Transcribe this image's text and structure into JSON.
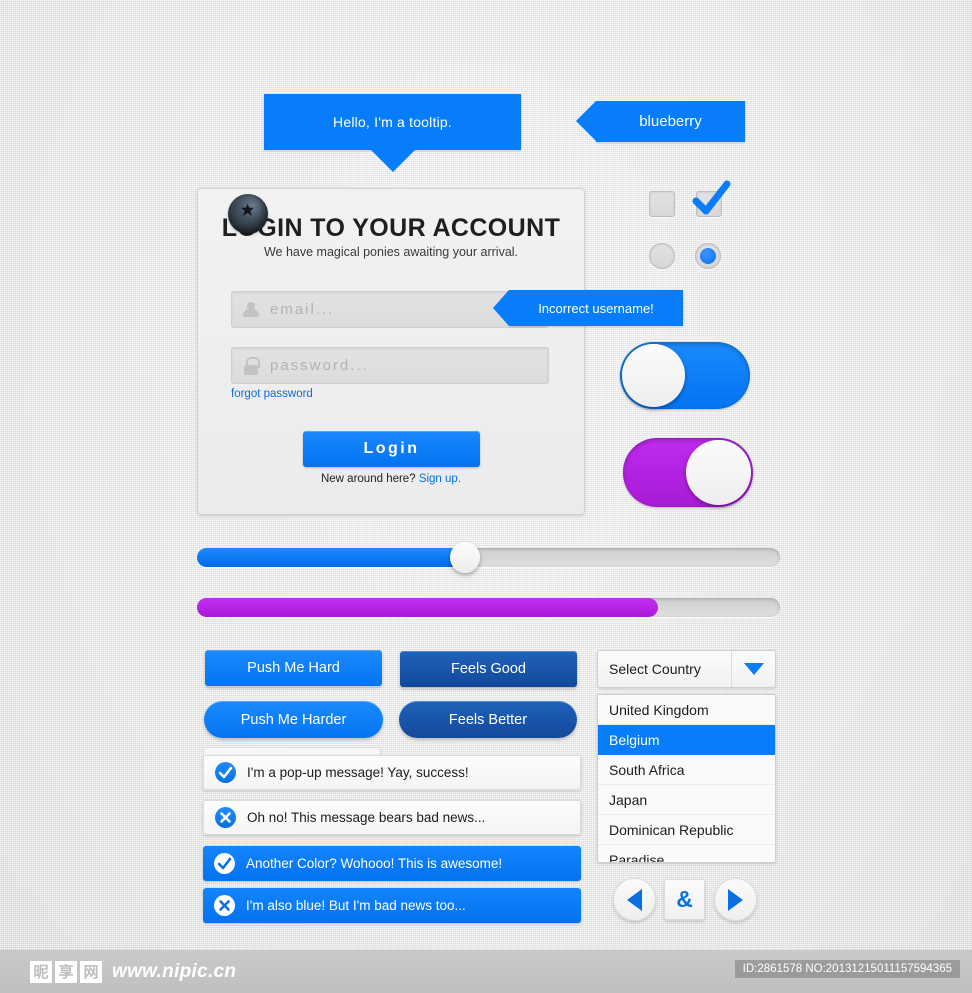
{
  "tooltips": {
    "main": "Hello, I'm a tooltip.",
    "tag": "blueberry",
    "error": "Incorrect username!"
  },
  "login": {
    "title": "LOGIN TO YOUR ACCOUNT",
    "subtitle": "We have magical ponies awaiting your arrival.",
    "email_placeholder": "email...",
    "password_placeholder": "password...",
    "forgot_label": "forgot password",
    "submit_label": "Login",
    "footer_prefix": "New around here?",
    "footer_link": "Sign up.",
    "email_icon": "user-icon",
    "password_icon": "lock-icon",
    "logo_icon": "blueberry-icon"
  },
  "controls": {
    "checkbox_unchecked_state": "unchecked",
    "checkbox_checked_state": "checked",
    "radio_off_state": "off",
    "radio_on_state": "on",
    "toggle_blue_state": "off",
    "toggle_purple_state": "on"
  },
  "sliders": {
    "blue_value": 46,
    "blue_color": "#0a7cf7",
    "purple_value": 79,
    "purple_color": "#b526e8"
  },
  "buttons": {
    "push_hard": "Push Me Hard",
    "feels_good": "Feels Good",
    "push_harder": "Push Me Harder",
    "feels_better": "Feels Better"
  },
  "select": {
    "label": "Select Country",
    "arrow_icon": "chevron-down-icon",
    "options": [
      "United Kingdom",
      "Belgium",
      "South Africa",
      "Japan",
      "Dominican Republic",
      "Paradise"
    ],
    "selected": "Belgium"
  },
  "alerts": [
    {
      "text": "I'm a pop-up message! Yay, success!",
      "icon": "check-icon",
      "style": "light"
    },
    {
      "text": "Oh no! This message bears bad news...",
      "icon": "cross-icon",
      "style": "light"
    },
    {
      "text": "Another Color? Wohooo! This is awesome!",
      "icon": "check-icon",
      "style": "blue"
    },
    {
      "text": "I'm also blue! But I'm bad news too...",
      "icon": "cross-icon",
      "style": "blue"
    }
  ],
  "pager": {
    "prev_icon": "triangle-left-icon",
    "next_icon": "triangle-right-icon",
    "middle_label": "&"
  },
  "footer": {
    "brand_chars": [
      "昵",
      "享",
      "网"
    ],
    "url": "www.nipic.cn",
    "id_text": "ID:2861578 NO:20131215011157594365"
  },
  "theme": {
    "accent_blue": "#077dfc",
    "navy_blue": "#14529e",
    "purple": "#b526e8",
    "panel_bg": "#efefef"
  }
}
